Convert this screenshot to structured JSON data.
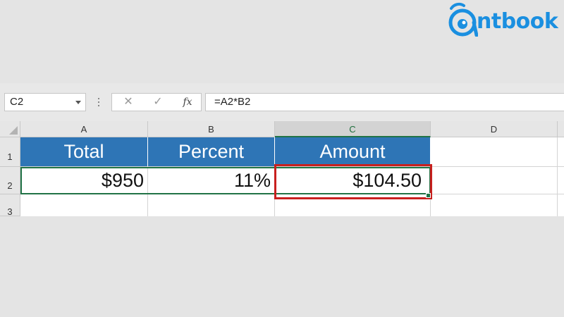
{
  "logo": {
    "text": "ntbook",
    "icon": "owl-icon",
    "color": "#1a8fe0"
  },
  "formula_bar": {
    "name_box": "C2",
    "cancel_icon": "✕",
    "enter_icon": "✓",
    "fx_label": "fx",
    "formula": "=A2*B2"
  },
  "columns": [
    "A",
    "B",
    "C",
    "D"
  ],
  "selected_column": "C",
  "rows": [
    "1",
    "2",
    "3"
  ],
  "table": {
    "headers": [
      "Total",
      "Percent",
      "Amount"
    ],
    "values": [
      "$950",
      "11%",
      "$104.50"
    ]
  },
  "colors": {
    "header_fill": "#2e75b6",
    "selection_green": "#217346",
    "highlight_red": "#c8201e"
  }
}
